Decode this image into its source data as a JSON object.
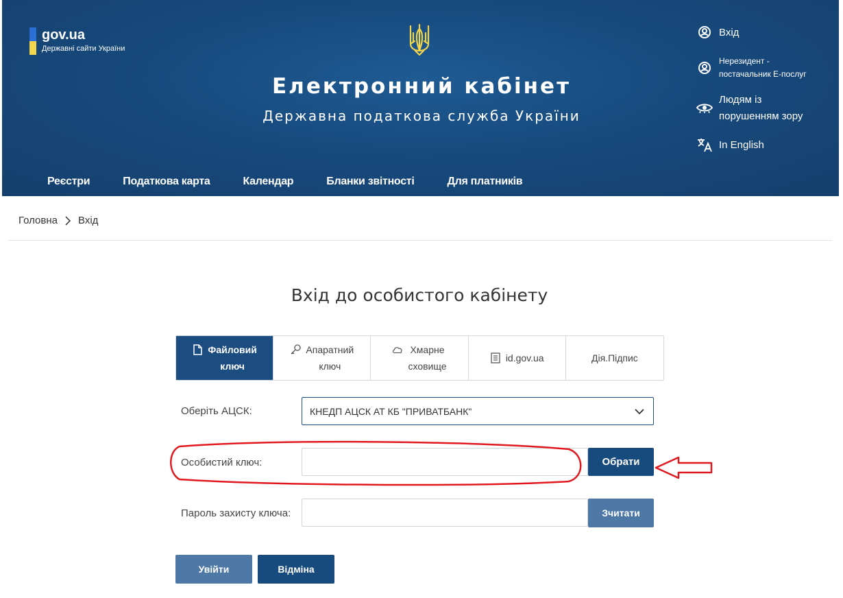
{
  "gov": {
    "title": "gov.ua",
    "subtitle": "Державні сайти України"
  },
  "header": {
    "title": "Електронний кабінет",
    "subtitle": "Державна податкова служба України"
  },
  "right_menu": [
    {
      "label": "Вхід",
      "icon": "user-icon"
    },
    {
      "label_line1": "Нерезидент -",
      "label_line2": "постачальник Е-послуг",
      "icon": "user-icon"
    },
    {
      "label_line1": "Людям із",
      "label_line2": "порушенням зору",
      "icon": "eye-icon"
    },
    {
      "label": "In English",
      "icon": "translate-icon"
    }
  ],
  "nav": [
    "Реєстри",
    "Податкова карта",
    "Календар",
    "Бланки звітності",
    "Для платників"
  ],
  "breadcrumb": {
    "home": "Головна",
    "current": "Вхід"
  },
  "login": {
    "title": "Вхід до особистого кабінету",
    "tabs": [
      {
        "line1": "Файловий",
        "line2": "ключ",
        "icon": "file-icon",
        "active": true
      },
      {
        "line1": "Апаратний",
        "line2": "ключ",
        "icon": "key-icon",
        "active": false
      },
      {
        "line1": "Хмарне",
        "line2": "сховище",
        "icon": "cloud-icon",
        "active": false
      },
      {
        "label": "id.gov.ua",
        "icon": "document-icon",
        "active": false
      },
      {
        "label": "Дія.Підпис",
        "active": false
      }
    ],
    "acsk_label": "Оберіть АЦСК:",
    "acsk_value": "КНЕДП АЦСК АТ КБ \"ПРИВАТБАНК\"",
    "key_label": "Особистий ключ:",
    "key_value": "",
    "choose_button": "Обрати",
    "password_label": "Пароль захисту ключа:",
    "password_value": "",
    "read_button": "Зчитати",
    "login_button": "Увійти",
    "cancel_button": "Відміна"
  },
  "colors": {
    "header_bg": "#174a7d",
    "primary": "#174a7d",
    "secondary_button": "#4e79a6",
    "annotation": "#e0191f",
    "flag_blue": "#2c6fd6",
    "flag_yellow": "#f2d54a"
  }
}
